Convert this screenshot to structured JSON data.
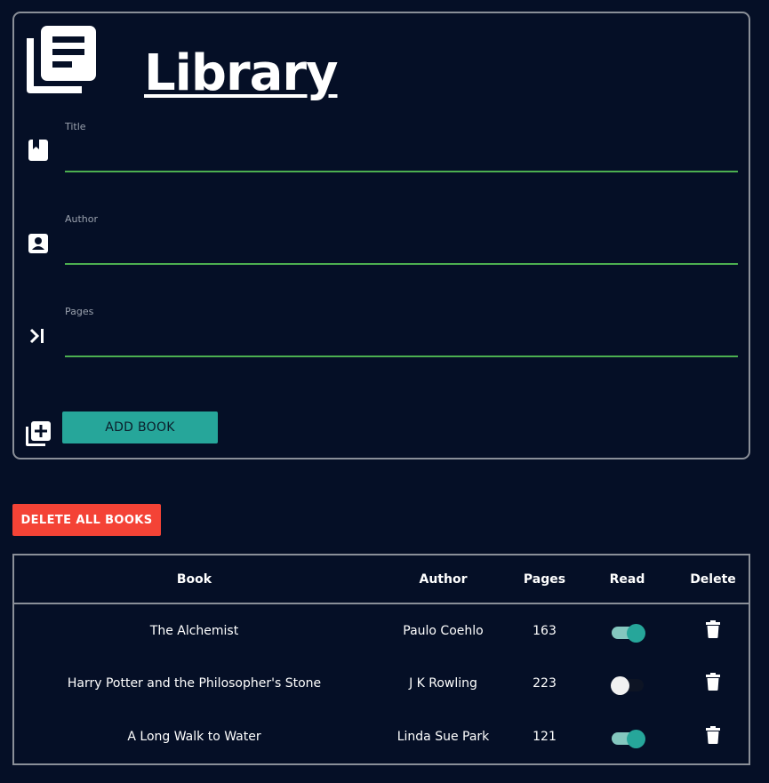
{
  "header": {
    "title": "Library",
    "logo_icon": "library-books-icon"
  },
  "form": {
    "fields": [
      {
        "label": "Title",
        "icon": "bookmark-book-icon",
        "value": "",
        "placeholder": ""
      },
      {
        "label": "Author",
        "icon": "contact-person-icon",
        "value": "",
        "placeholder": ""
      },
      {
        "label": "Pages",
        "icon": "skip-next-icon",
        "value": "",
        "placeholder": ""
      }
    ],
    "add_button": {
      "label": "ADD BOOK",
      "icon": "library-add-icon"
    }
  },
  "delete_all_button": {
    "label": "DELETE ALL BOOKS"
  },
  "table": {
    "headers": [
      "Book",
      "Author",
      "Pages",
      "Read",
      "Delete"
    ],
    "rows": [
      {
        "book": "The Alchemist",
        "author": "Paulo Coehlo",
        "pages": "163",
        "read": true
      },
      {
        "book": "Harry Potter and the Philosopher's Stone",
        "author": "J K Rowling",
        "pages": "223",
        "read": false
      },
      {
        "book": "A Long Walk to Water",
        "author": "Linda Sue Park",
        "pages": "121",
        "read": true
      }
    ],
    "delete_icon": "trash-icon"
  },
  "colors": {
    "background": "#050f26",
    "accent_teal": "#26a69a",
    "input_underline": "#4caf50",
    "danger": "#f44336",
    "border": "#8a8f98"
  }
}
